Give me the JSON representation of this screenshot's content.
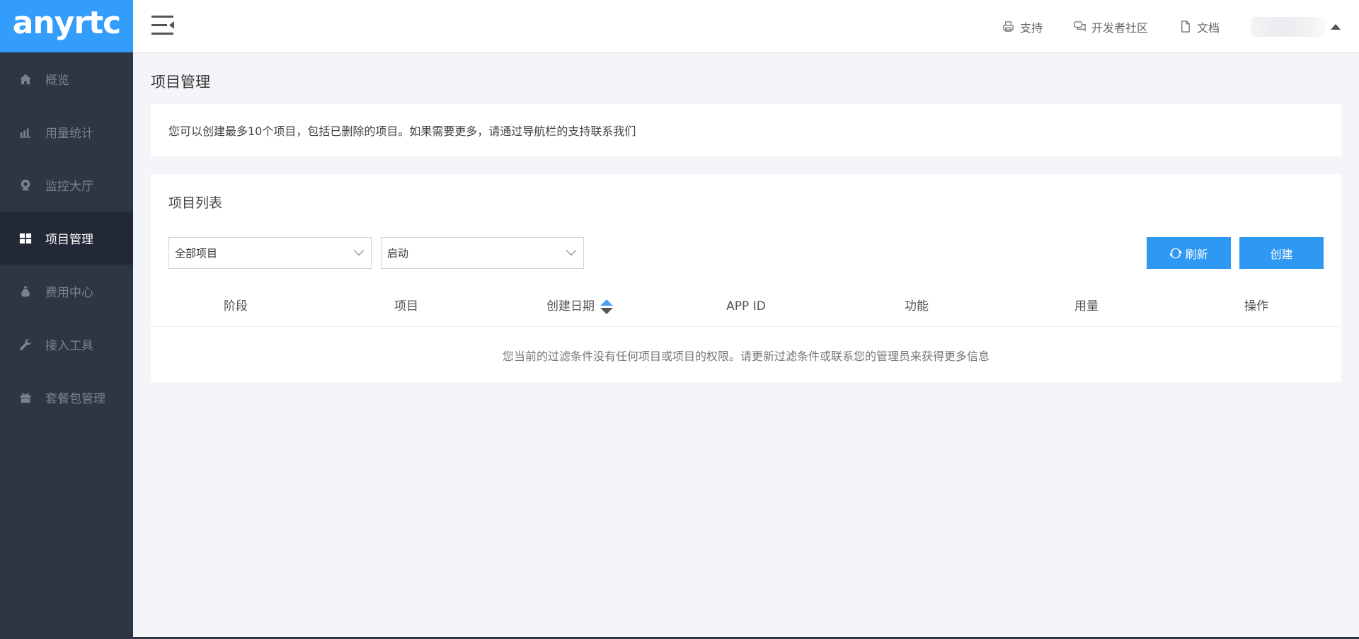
{
  "brand": {
    "logo_text": "anyrtc"
  },
  "sidebar": {
    "items": [
      {
        "label": "概览",
        "icon": "home-icon",
        "active": false
      },
      {
        "label": "用量统计",
        "icon": "bar-chart-icon",
        "active": false
      },
      {
        "label": "监控大厅",
        "icon": "webcam-icon",
        "active": false
      },
      {
        "label": "项目管理",
        "icon": "grid-icon",
        "active": true
      },
      {
        "label": "费用中心",
        "icon": "money-bag-icon",
        "active": false
      },
      {
        "label": "接入工具",
        "icon": "wrench-icon",
        "active": false
      },
      {
        "label": "套餐包管理",
        "icon": "gift-icon",
        "active": false
      }
    ]
  },
  "header": {
    "links": [
      {
        "label": "支持",
        "icon": "printer-icon"
      },
      {
        "label": "开发者社区",
        "icon": "chat-bubbles-icon"
      },
      {
        "label": "文档",
        "icon": "document-icon"
      }
    ]
  },
  "main": {
    "page_title": "项目管理",
    "notice": "您可以创建最多10个项目，包括已删除的项目。如果需要更多，请通过导航栏的支持联系我们",
    "panel": {
      "title": "项目列表",
      "filter_project": "全部项目",
      "filter_status": "启动",
      "refresh_label": "刷新",
      "create_label": "创建",
      "columns": [
        "阶段",
        "项目",
        "创建日期",
        "APP ID",
        "功能",
        "用量",
        "操作"
      ],
      "empty_message": "您当前的过滤条件没有任何项目或项目的权限。请更新过滤条件或联系您的管理员来获得更多信息"
    }
  },
  "colors": {
    "accent": "#339dfc",
    "button": "#2f98f2",
    "sidebar_bg": "#2e3543",
    "sidebar_active": "#222836"
  }
}
